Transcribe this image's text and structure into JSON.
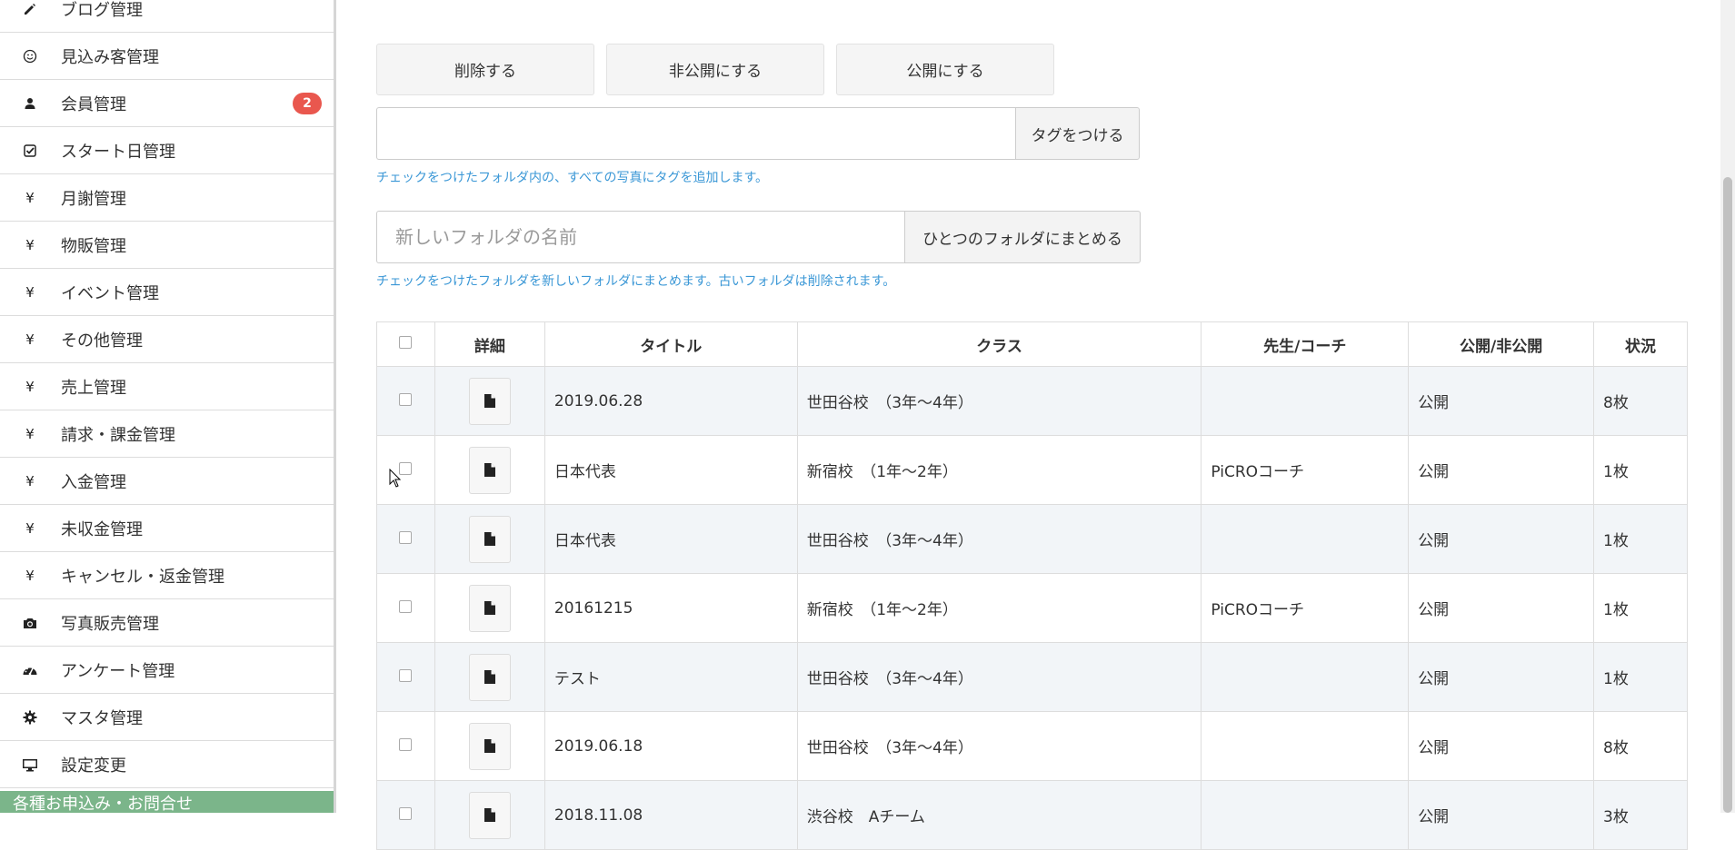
{
  "sidebar": {
    "items": [
      {
        "label": "ブログ管理",
        "icon": "pencil-icon"
      },
      {
        "label": "見込み客管理",
        "icon": "smiley-icon"
      },
      {
        "label": "会員管理",
        "icon": "user-icon",
        "badge": "2"
      },
      {
        "label": "スタート日管理",
        "icon": "check-square-icon"
      },
      {
        "label": "月謝管理",
        "icon": "yen-icon"
      },
      {
        "label": "物販管理",
        "icon": "yen-icon"
      },
      {
        "label": "イベント管理",
        "icon": "yen-icon"
      },
      {
        "label": "その他管理",
        "icon": "yen-icon"
      },
      {
        "label": "売上管理",
        "icon": "yen-icon"
      },
      {
        "label": "請求・課金管理",
        "icon": "yen-icon"
      },
      {
        "label": "入金管理",
        "icon": "yen-icon"
      },
      {
        "label": "未収金管理",
        "icon": "yen-icon"
      },
      {
        "label": "キャンセル・返金管理",
        "icon": "yen-icon"
      },
      {
        "label": "写真販売管理",
        "icon": "camera-icon"
      },
      {
        "label": "アンケート管理",
        "icon": "dashboard-icon"
      },
      {
        "label": "マスタ管理",
        "icon": "gear-icon"
      },
      {
        "label": "設定変更",
        "icon": "monitor-icon"
      }
    ],
    "bottom_label": "各種お申込み・お問合せ",
    "yen_glyph": "¥"
  },
  "actions": {
    "delete_label": "削除する",
    "unpublish_label": "非公開にする",
    "publish_label": "公開にする"
  },
  "tag": {
    "input_value": "",
    "button_label": "タグをつける",
    "help": "チェックをつけたフォルダ内の、すべての写真にタグを追加します。"
  },
  "merge": {
    "placeholder": "新しいフォルダの名前",
    "button_label": "ひとつのフォルダにまとめる",
    "help": "チェックをつけたフォルダを新しいフォルダにまとめます。古いフォルダは削除されます。"
  },
  "table": {
    "headers": {
      "detail": "詳細",
      "title": "タイトル",
      "class": "クラス",
      "teacher": "先生/コーチ",
      "visibility": "公開/非公開",
      "status": "状況"
    },
    "rows": [
      {
        "title": "2019.06.28",
        "class": "世田谷校　（3年～4年）",
        "teacher": "",
        "visibility": "公開",
        "status": "8枚"
      },
      {
        "title": "日本代表",
        "class": "新宿校　（1年～2年）",
        "teacher": "PiCROコーチ",
        "visibility": "公開",
        "status": "1枚"
      },
      {
        "title": "日本代表",
        "class": "世田谷校　（3年～4年）",
        "teacher": "",
        "visibility": "公開",
        "status": "1枚"
      },
      {
        "title": "20161215",
        "class": "新宿校　（1年～2年）",
        "teacher": "PiCROコーチ",
        "visibility": "公開",
        "status": "1枚"
      },
      {
        "title": "テスト",
        "class": "世田谷校　（3年～4年）",
        "teacher": "",
        "visibility": "公開",
        "status": "1枚"
      },
      {
        "title": "2019.06.18",
        "class": "世田谷校　（3年～4年）",
        "teacher": "",
        "visibility": "公開",
        "status": "8枚"
      },
      {
        "title": "2018.11.08",
        "class": "渋谷校　Aチーム",
        "teacher": "",
        "visibility": "公開",
        "status": "3枚"
      }
    ]
  },
  "colors": {
    "accent_green": "#7bb58a",
    "badge_red": "#e9574e",
    "help_blue": "#3a97d6",
    "row_stripe": "#f2f5f8"
  }
}
